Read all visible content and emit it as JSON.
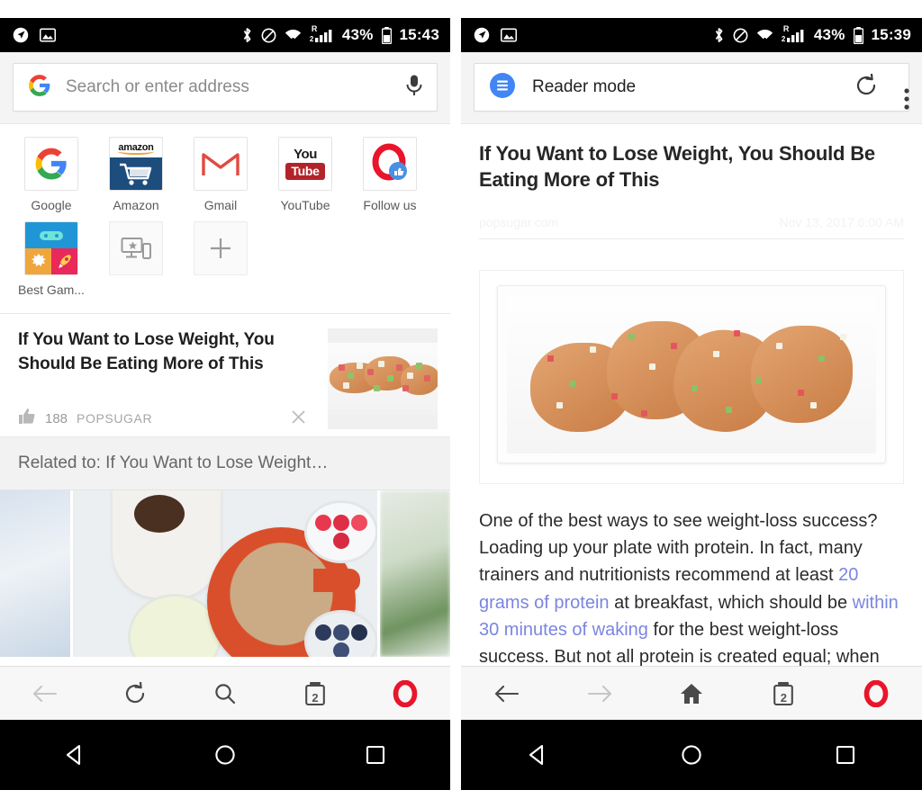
{
  "left_phone": {
    "status_bar": {
      "icons": [
        "location-icon",
        "screenshot-icon",
        "bluetooth-icon",
        "do-not-disturb-icon",
        "wifi-icon",
        "cell-signal-icon"
      ],
      "roaming_label": "R",
      "sim_label": "2",
      "battery_percent": "43%",
      "time": "15:43"
    },
    "omnibox": {
      "placeholder": "Search or enter address",
      "engine_icon": "google-g-icon",
      "mic_icon": "microphone-icon"
    },
    "speed_dial": {
      "row1": [
        {
          "label": "Google",
          "icon": "google-g-icon"
        },
        {
          "label": "Amazon",
          "icon": "amazon-icon",
          "wordmark": "amazon"
        },
        {
          "label": "Gmail",
          "icon": "gmail-icon"
        },
        {
          "label": "YouTube",
          "icon": "youtube-icon",
          "word_top": "You",
          "word_bottom": "Tube"
        },
        {
          "label": "Follow us",
          "icon": "opera-follow-us-icon"
        }
      ],
      "row2": [
        {
          "label": "Best Gam...",
          "icon": "best-games-icon"
        },
        {
          "label": "",
          "icon": "sync-devices-icon"
        },
        {
          "label": "",
          "icon": "plus-icon"
        }
      ]
    },
    "news_card": {
      "title": "If You Want to Lose Weight, You Should Be Eating More of This",
      "likes": "188",
      "source": "POPSUGAR",
      "like_icon": "thumbs-up-icon",
      "close_icon": "close-icon",
      "thumbnail": "chicken-salsa-thumbnail"
    },
    "related_bar": {
      "text": "Related to: If You Want to Lose Weight…"
    },
    "photo_strip": {
      "left": "sky-photo",
      "center": "oatmeal-breakfast-photo",
      "right": "greens-photo"
    },
    "browser_bar": [
      {
        "name": "back-button",
        "icon": "arrow-left-icon",
        "enabled": false
      },
      {
        "name": "reload-button",
        "icon": "reload-icon",
        "enabled": true
      },
      {
        "name": "search-button",
        "icon": "search-icon",
        "enabled": true
      },
      {
        "name": "tabs-button",
        "icon": "tabs-icon",
        "count": "2"
      },
      {
        "name": "opera-menu-button",
        "icon": "opera-logo-icon"
      }
    ],
    "android_nav": [
      {
        "name": "nav-back",
        "icon": "triangle-back-icon"
      },
      {
        "name": "nav-home",
        "icon": "circle-home-icon"
      },
      {
        "name": "nav-recents",
        "icon": "square-recents-icon"
      }
    ]
  },
  "right_phone": {
    "status_bar": {
      "icons": [
        "location-icon",
        "screenshot-icon",
        "bluetooth-icon",
        "do-not-disturb-icon",
        "wifi-icon",
        "cell-signal-icon"
      ],
      "roaming_label": "R",
      "sim_label": "2",
      "battery_percent": "43%",
      "time": "15:39"
    },
    "omnibox": {
      "mode_label": "Reader mode",
      "mode_icon": "reader-mode-icon",
      "reload_icon": "reload-icon",
      "menu_icon": "overflow-menu-icon"
    },
    "article": {
      "title": "If You Want to Lose Weight, You Should Be Eating More of This",
      "source": "popsugar.com",
      "date": "Nov 13, 2017 6:00 AM",
      "hero_image": "chicken-with-salsa-on-white-platter",
      "body": {
        "segments": [
          {
            "type": "text",
            "value": "One of the best ways to see weight-loss success? Loading up your plate with protein. In fact, many trainers and nutritionists recommend at least "
          },
          {
            "type": "link",
            "value": "20 grams of protein"
          },
          {
            "type": "text",
            "value": " at breakfast, which should be "
          },
          {
            "type": "link",
            "value": "within 30 minutes of waking"
          },
          {
            "type": "text",
            "value": " for the best weight-loss success. But not all protein is created equal; when searching for the best way to fuel up"
          }
        ]
      }
    },
    "browser_bar": [
      {
        "name": "back-button",
        "icon": "arrow-left-icon",
        "enabled": true
      },
      {
        "name": "forward-button",
        "icon": "arrow-right-icon",
        "enabled": false
      },
      {
        "name": "home-button",
        "icon": "home-icon",
        "enabled": true
      },
      {
        "name": "tabs-button",
        "icon": "tabs-icon",
        "count": "2"
      },
      {
        "name": "opera-menu-button",
        "icon": "opera-logo-icon"
      }
    ],
    "android_nav": [
      {
        "name": "nav-back",
        "icon": "triangle-back-icon"
      },
      {
        "name": "nav-home",
        "icon": "circle-home-icon"
      },
      {
        "name": "nav-recents",
        "icon": "square-recents-icon"
      }
    ]
  },
  "colors": {
    "opera_red": "#e8152b",
    "link_blue": "#7b85e0",
    "reader_blue": "#4285f4",
    "status_black": "#000000",
    "toolbar_grey": "#f7f7f7"
  }
}
